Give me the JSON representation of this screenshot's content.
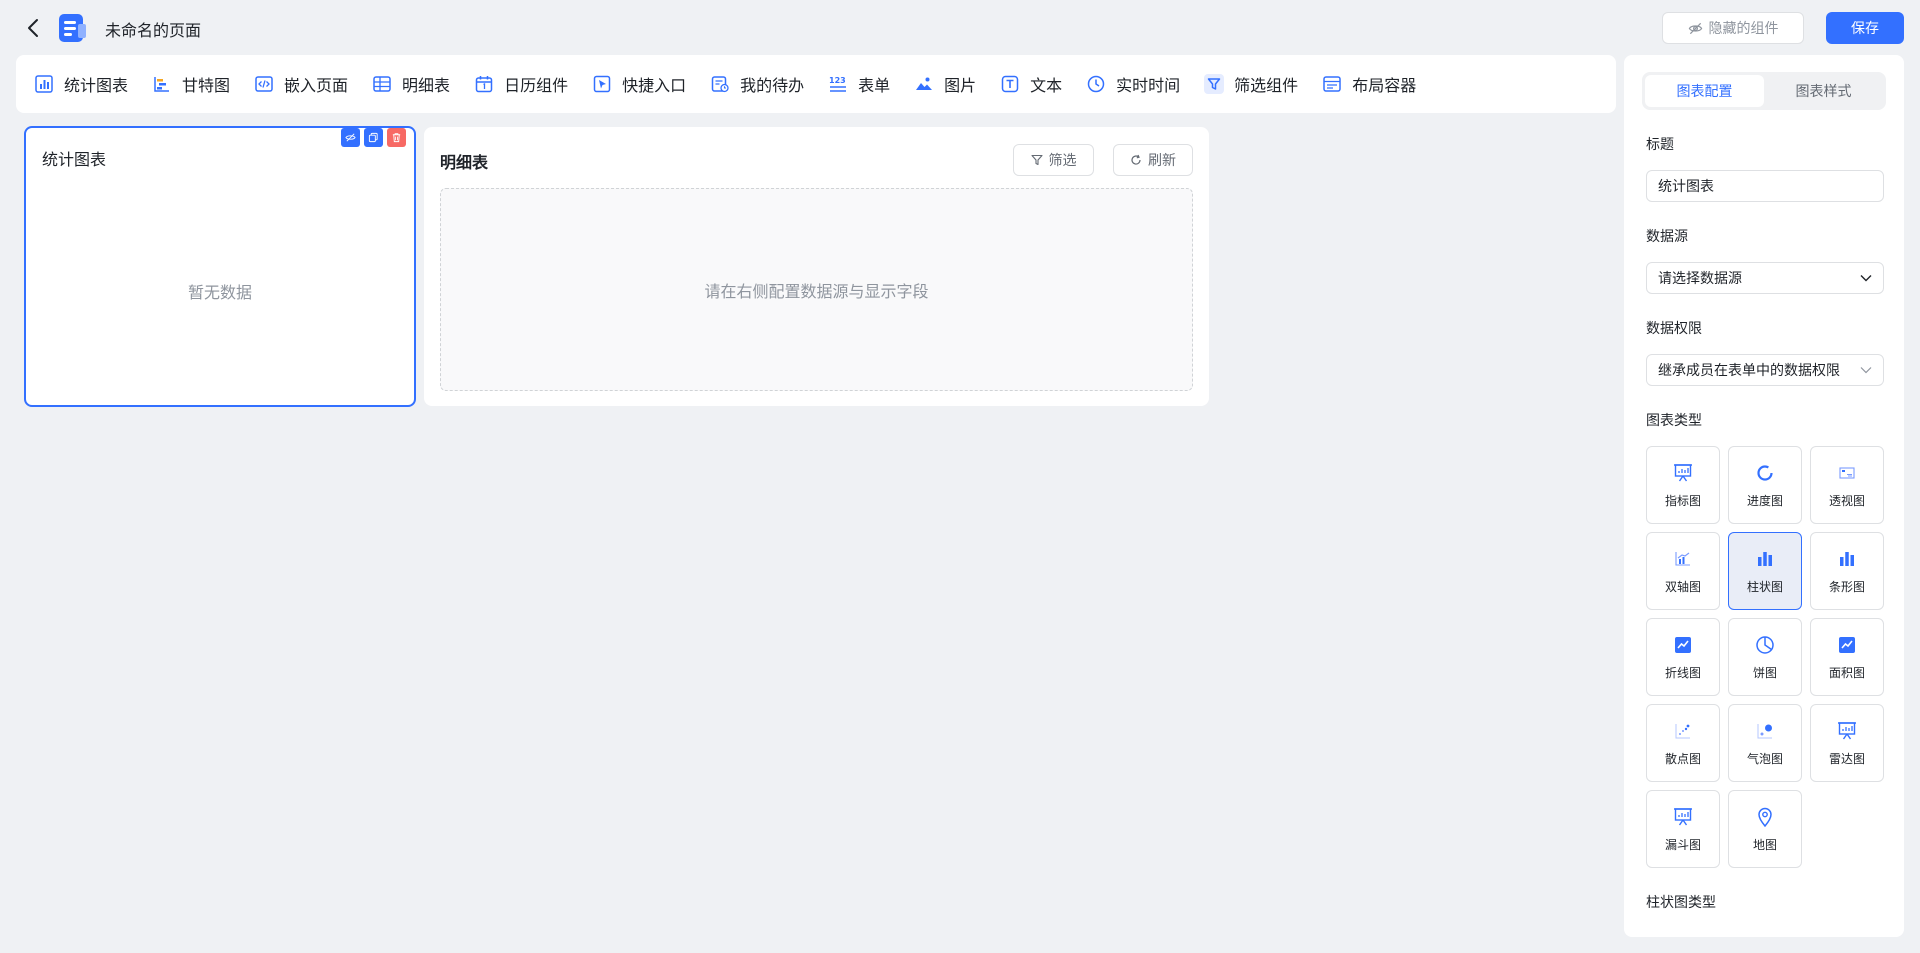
{
  "header": {
    "page_title": "未命名的页面",
    "hidden_components_label": "隐藏的组件",
    "save_label": "保存"
  },
  "toolbar": {
    "items": [
      {
        "label": "统计图表",
        "icon": "bar-chart-icon"
      },
      {
        "label": "甘特图",
        "icon": "gantt-icon"
      },
      {
        "label": "嵌入页面",
        "icon": "embed-code-icon"
      },
      {
        "label": "明细表",
        "icon": "table-icon"
      },
      {
        "label": "日历组件",
        "icon": "calendar-icon"
      },
      {
        "label": "快捷入口",
        "icon": "shortcut-icon"
      },
      {
        "label": "我的待办",
        "icon": "todo-icon"
      },
      {
        "label": "表单",
        "icon": "form-123-icon"
      },
      {
        "label": "图片",
        "icon": "image-icon"
      },
      {
        "label": "文本",
        "icon": "text-icon"
      },
      {
        "label": "实时时间",
        "icon": "clock-icon"
      },
      {
        "label": "筛选组件",
        "icon": "filter-icon"
      },
      {
        "label": "布局容器",
        "icon": "layout-container-icon"
      }
    ]
  },
  "canvas": {
    "stat_card": {
      "title": "统计图表",
      "empty_text": "暂无数据"
    },
    "table_card": {
      "title": "明细表",
      "filter_label": "筛选",
      "refresh_label": "刷新",
      "placeholder": "请在右侧配置数据源与显示字段"
    }
  },
  "panel": {
    "tabs": [
      "图表配置",
      "图表样式"
    ],
    "title_label": "标题",
    "title_value": "统计图表",
    "datasource_label": "数据源",
    "datasource_value": "请选择数据源",
    "permission_label": "数据权限",
    "permission_value": "继承成员在表单中的数据权限",
    "chart_type_label": "图表类型",
    "chart_types": [
      {
        "label": "指标图",
        "icon": "presentation-chart-icon"
      },
      {
        "label": "进度图",
        "icon": "progress-ring-icon"
      },
      {
        "label": "透视图",
        "icon": "pivot-icon"
      },
      {
        "label": "双轴图",
        "icon": "dual-axis-icon"
      },
      {
        "label": "柱状图",
        "icon": "column-chart-icon",
        "selected": true
      },
      {
        "label": "条形图",
        "icon": "bar-chart-icon"
      },
      {
        "label": "折线图",
        "icon": "line-chart-icon"
      },
      {
        "label": "饼图",
        "icon": "pie-chart-icon"
      },
      {
        "label": "面积图",
        "icon": "area-chart-icon"
      },
      {
        "label": "散点图",
        "icon": "scatter-chart-icon"
      },
      {
        "label": "气泡图",
        "icon": "bubble-chart-icon"
      },
      {
        "label": "雷达图",
        "icon": "radar-chart-icon"
      },
      {
        "label": "漏斗图",
        "icon": "funnel-chart-icon"
      },
      {
        "label": "地图",
        "icon": "map-pin-icon"
      }
    ],
    "bar_type_label": "柱状图类型"
  },
  "colors": {
    "accent": "#3370ff",
    "danger": "#f76964",
    "background": "#eff1f4"
  }
}
